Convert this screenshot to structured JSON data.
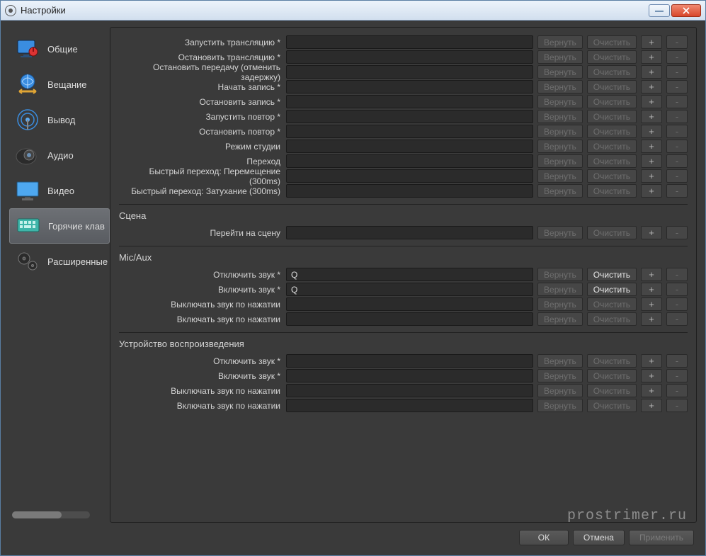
{
  "window": {
    "title": "Настройки"
  },
  "buttons": {
    "revert": "Вернуть",
    "clear": "Очистить"
  },
  "sidebar": {
    "items": [
      {
        "label": "Общие"
      },
      {
        "label": "Вещание"
      },
      {
        "label": "Вывод"
      },
      {
        "label": "Аудио"
      },
      {
        "label": "Видео"
      },
      {
        "label": "Горячие клав"
      },
      {
        "label": "Расширенные"
      }
    ]
  },
  "hotkeys": {
    "main": [
      {
        "label": "Запустить трансляцию *",
        "value": "",
        "revert": false,
        "clear": false,
        "plus": true,
        "minus": true
      },
      {
        "label": "Остановить трансляцию *",
        "value": "",
        "revert": false,
        "clear": false,
        "plus": true,
        "minus": true
      },
      {
        "label": "Остановить передачу (отменить задержку)",
        "value": "",
        "revert": false,
        "clear": false,
        "plus": true,
        "minus": true
      },
      {
        "label": "Начать запись *",
        "value": "",
        "revert": false,
        "clear": false,
        "plus": true,
        "minus": true
      },
      {
        "label": "Остановить запись *",
        "value": "",
        "revert": false,
        "clear": false,
        "plus": true,
        "minus": true
      },
      {
        "label": "Запустить повтор *",
        "value": "",
        "revert": false,
        "clear": false,
        "plus": true,
        "minus": true
      },
      {
        "label": "Остановить повтор *",
        "value": "",
        "revert": false,
        "clear": false,
        "plus": true,
        "minus": true
      },
      {
        "label": "Режим студии",
        "value": "",
        "revert": false,
        "clear": false,
        "plus": true,
        "minus": true
      },
      {
        "label": "Переход",
        "value": "",
        "revert": false,
        "clear": false,
        "plus": true,
        "minus": true
      },
      {
        "label": "Быстрый переход: Перемещение (300ms)",
        "value": "",
        "revert": false,
        "clear": false,
        "plus": true,
        "minus": true
      },
      {
        "label": "Быстрый переход: Затухание (300ms)",
        "value": "",
        "revert": false,
        "clear": false,
        "plus": true,
        "minus": true
      }
    ],
    "scene": {
      "title": "Сцена",
      "rows": [
        {
          "label": "Перейти на сцену",
          "value": "",
          "revert": false,
          "clear": false,
          "plus": true,
          "minus": true
        }
      ]
    },
    "micaux": {
      "title": "Mic/Aux",
      "rows": [
        {
          "label": "Отключить звук *",
          "value": "Q",
          "revert": false,
          "clear": true,
          "plus": true,
          "minus": true
        },
        {
          "label": "Включить звук *",
          "value": "Q",
          "revert": false,
          "clear": true,
          "plus": true,
          "minus": true
        },
        {
          "label": "Выключать звук по нажатии",
          "value": "",
          "revert": false,
          "clear": false,
          "plus": true,
          "minus": true
        },
        {
          "label": "Включать звук по нажатии",
          "value": "",
          "revert": false,
          "clear": false,
          "plus": true,
          "minus": true
        }
      ]
    },
    "playback": {
      "title": "Устройство воспроизведения",
      "rows": [
        {
          "label": "Отключить звук *",
          "value": "",
          "revert": false,
          "clear": false,
          "plus": true,
          "minus": true
        },
        {
          "label": "Включить звук *",
          "value": "",
          "revert": false,
          "clear": false,
          "plus": true,
          "minus": true
        },
        {
          "label": "Выключать звук по нажатии",
          "value": "",
          "revert": false,
          "clear": false,
          "plus": true,
          "minus": true
        },
        {
          "label": "Включать звук по нажатии",
          "value": "",
          "revert": false,
          "clear": false,
          "plus": true,
          "minus": true
        }
      ]
    }
  },
  "footer": {
    "ok": "ОК",
    "cancel": "Отмена",
    "apply": "Применить"
  },
  "watermark": "prostrimer.ru"
}
